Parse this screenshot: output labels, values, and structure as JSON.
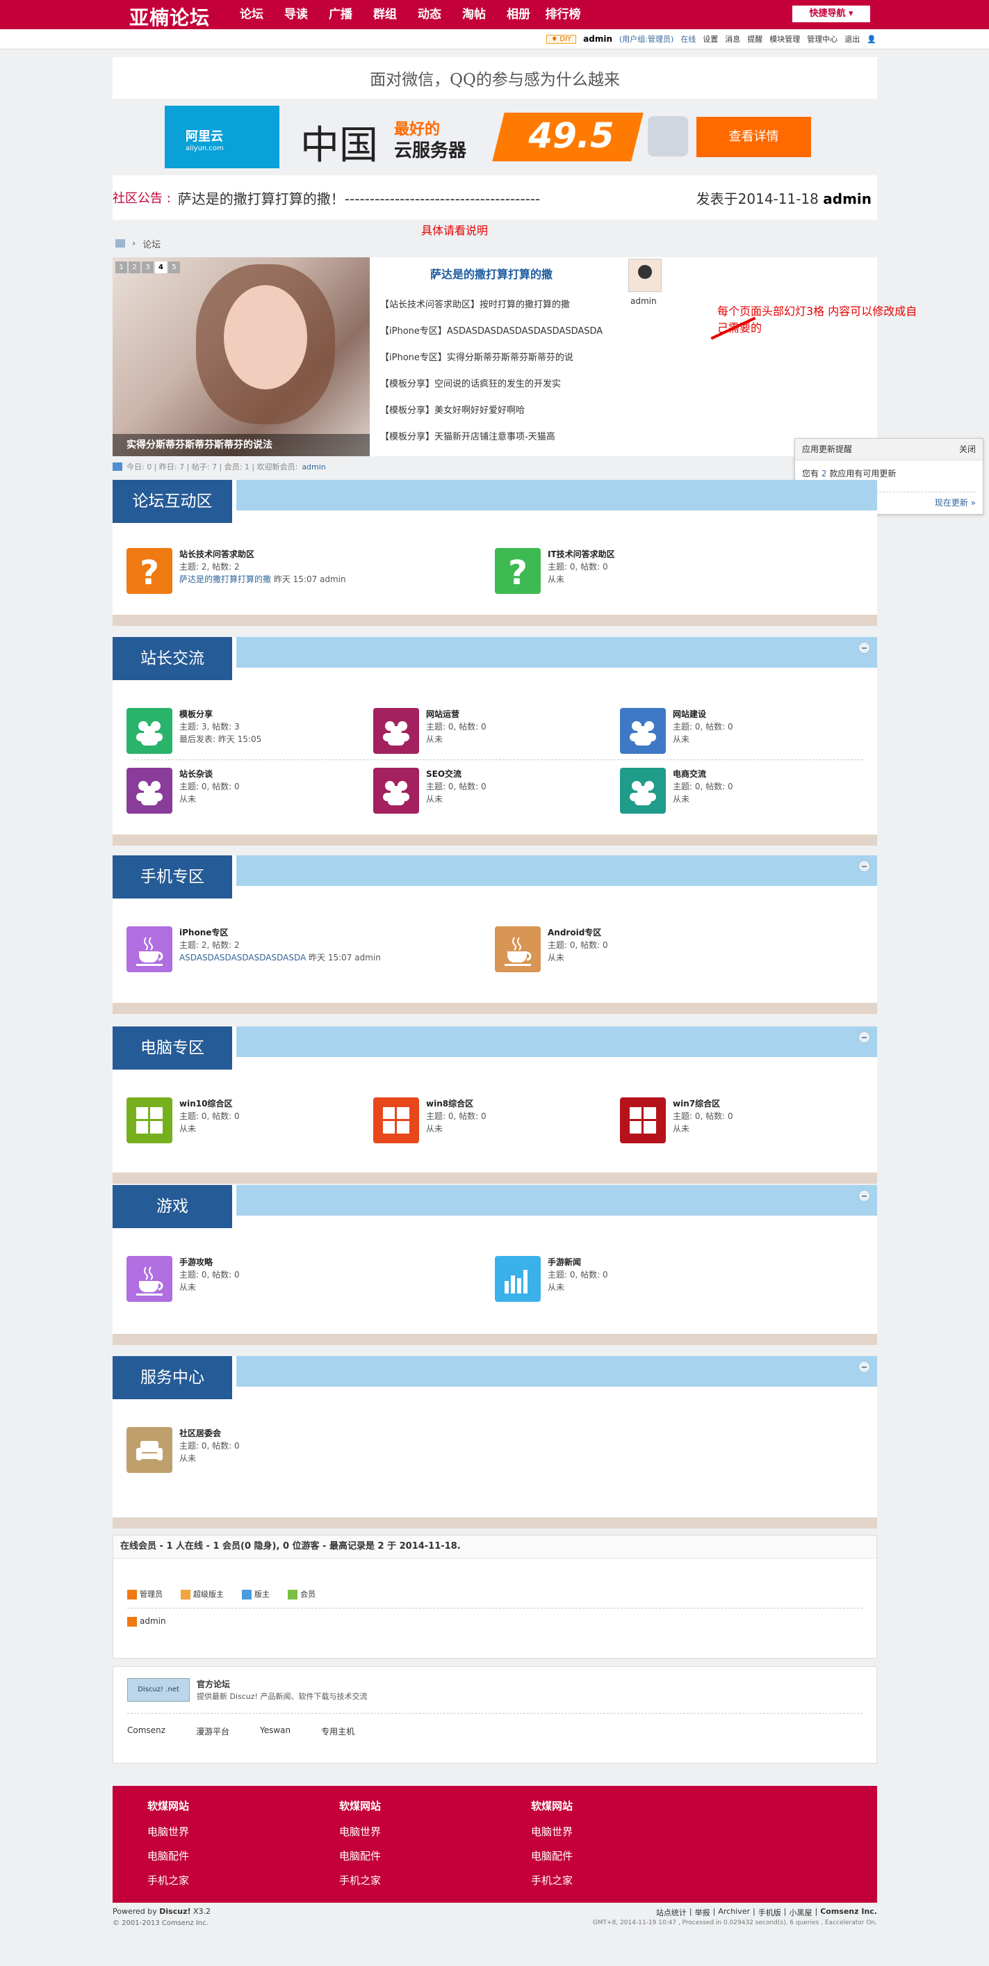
{
  "header": {
    "logo": "亚楠论坛",
    "nav": [
      "论坛",
      "导读",
      "广播",
      "群组",
      "动态",
      "淘帖",
      "相册",
      "排行榜"
    ],
    "quick": "快捷导航 ▾"
  },
  "userbar": {
    "diy": "♦ DIY",
    "name": "admin",
    "group": "(用户组:管理员)",
    "items": [
      "在线",
      "设置",
      "消息",
      "提醒",
      "模块管理",
      "管理中心",
      "退出"
    ]
  },
  "top_banner": {
    "text": "面对微信，QQ的参与感为什么越来"
  },
  "ad": {
    "brand": "阿里云",
    "brand_url": "aliyun.com",
    "china": "中国",
    "best": "最好的",
    "cloud": "云服务器",
    "price": "49.5",
    "button": "查看详情"
  },
  "notice": {
    "label": "社区公告 :",
    "text": "萨达是的撒打算打算的撒！---------------------------------------",
    "date": "发表于2014-11-18",
    "author": "admin",
    "note": "具体请看说明"
  },
  "breadcrumb": {
    "item": "论坛"
  },
  "slide": {
    "dots": [
      "1",
      "2",
      "3",
      "4",
      "5"
    ],
    "caption": "实得分斯蒂芬斯蒂芬斯蒂芬的说法",
    "hot_title": "萨达是的撒打算打算的撒",
    "hot_items": [
      "【站长技术问答求助区】按时打算的撒打算的撒",
      "【iPhone专区】ASDASDASDASDASDASDASDASDA",
      "【iPhone专区】实得分斯蒂芬斯蒂芬斯蒂芬的说",
      "【模板分享】空间说的话疯狂的发生的开发实",
      "【模板分享】美女好啊好好爱好啊哈",
      "【模板分享】天猫新开店铺注意事项-天猫高"
    ],
    "user": "admin",
    "note": "每个页面头部幻灯3格 内容可以修改成自己需要的"
  },
  "stats": {
    "text": "今日: 0 | 昨日: 7 | 帖子: 7 | 会员: 1 | 欢迎新会员:",
    "new_member": "admin"
  },
  "popup": {
    "title": "应用更新提醒",
    "close": "关闭",
    "body_pre": "您有",
    "count": "2",
    "body_post": "款应用有可用更新",
    "action": "现在更新 »"
  },
  "sections": {
    "s1": {
      "title": "论坛互动区"
    },
    "s2": {
      "title": "站长交流"
    },
    "s3": {
      "title": "手机专区"
    },
    "s4": {
      "title": "电脑专区"
    },
    "s5": {
      "title": "游戏"
    },
    "s6": {
      "title": "服务中心"
    }
  },
  "forums": {
    "f1": {
      "name": "站长技术问答求助区",
      "l1": "主题: 2, 帖数: 2",
      "l2a": "萨达是的撒打算打算的撒",
      "l2b": " 昨天 15:07 admin",
      "color": "#f07a12",
      "icon": "question-icon"
    },
    "f2": {
      "name": "IT技术问答求助区",
      "l1": "主题: 0, 帖数: 0",
      "l2": "从未",
      "color": "#3dba52",
      "icon": "question-icon"
    },
    "f3": {
      "name": "模板分享",
      "l1": "主题: 3, 帖数: 3",
      "l2": "最后发表: 昨天 15:05",
      "color": "#2ab36a",
      "icon": "group-icon"
    },
    "f4": {
      "name": "网站运营",
      "l1": "主题: 0, 帖数: 0",
      "l2": "从未",
      "color": "#a3215f",
      "icon": "group-icon"
    },
    "f5": {
      "name": "网站建设",
      "l1": "主题: 0, 帖数: 0",
      "l2": "从未",
      "color": "#3f79c6",
      "icon": "group-icon"
    },
    "f6": {
      "name": "站长杂谈",
      "l1": "主题: 0, 帖数: 0",
      "l2": "从未",
      "color": "#8a3c9a",
      "icon": "group-icon"
    },
    "f7": {
      "name": "SEO交流",
      "l1": "主题: 0, 帖数: 0",
      "l2": "从未",
      "color": "#a3215f",
      "icon": "group-icon"
    },
    "f8": {
      "name": "电商交流",
      "l1": "主题: 0, 帖数: 0",
      "l2": "从未",
      "color": "#1f9c8a",
      "icon": "group-icon"
    },
    "f9": {
      "name": "iPhone专区",
      "l1": "主题: 2, 帖数: 2",
      "l2a": "ASDASDASDASDASDASDASDA",
      "l2b": " 昨天 15:07 admin",
      "color": "#b06ee0",
      "icon": "cup-icon"
    },
    "f10": {
      "name": "Android专区",
      "l1": "主题: 0, 帖数: 0",
      "l2": "从未",
      "color": "#d99553",
      "icon": "cup-icon"
    },
    "f11": {
      "name": "win10综合区",
      "l1": "主题: 0, 帖数: 0",
      "l2": "从未",
      "color": "#76b01d",
      "icon": "windows-icon"
    },
    "f12": {
      "name": "win8综合区",
      "l1": "主题: 0, 帖数: 0",
      "l2": "从未",
      "color": "#e8471b",
      "icon": "windows-icon"
    },
    "f13": {
      "name": "win7综合区",
      "l1": "主题: 0, 帖数: 0",
      "l2": "从未",
      "color": "#b5121b",
      "icon": "windows-icon"
    },
    "f14": {
      "name": "手游攻略",
      "l1": "主题: 0, 帖数: 0",
      "l2": "从未",
      "color": "#b06ee0",
      "icon": "cup-icon"
    },
    "f15": {
      "name": "手游新闻",
      "l1": "主题: 0, 帖数: 0",
      "l2": "从未",
      "color": "#3ab1ea",
      "icon": "bars-icon"
    },
    "f16": {
      "name": "社区居委会",
      "l1": "主题: 0, 帖数: 0",
      "l2": "从未",
      "color": "#bfa06c",
      "icon": "sofa-icon"
    }
  },
  "online": {
    "title": "在线会员 - 1 人在线 - 1 会员(0 隐身), 0 位游客 - 最高记录是 2 于 2014-11-18.",
    "legend": [
      "管理员",
      "超级版主",
      "版主",
      "会员"
    ],
    "user": "admin"
  },
  "links": {
    "logo": "Discuz! .net",
    "title": "官方论坛",
    "desc": "提供最新 Discuz! 产品新闻、软件下载与技术交流",
    "items": [
      "Comsenz",
      "漫游平台",
      "Yeswan",
      "专用主机"
    ]
  },
  "footer": {
    "cols": [
      {
        "title": "软煤网站",
        "items": [
          "电脑世界",
          "电脑配件",
          "手机之家"
        ]
      },
      {
        "title": "软煤网站",
        "items": [
          "电脑世界",
          "电脑配件",
          "手机之家"
        ]
      },
      {
        "title": "软煤网站",
        "items": [
          "电脑世界",
          "电脑配件",
          "手机之家"
        ]
      }
    ],
    "powered": "Powered by",
    "discuz": "Discuz!",
    "version": "X3.2",
    "copyright": "© 2001-2013 Comsenz Inc.",
    "links": [
      "站点统计",
      "|",
      "举报",
      "|",
      "Archiver",
      "|",
      "手机版",
      "|",
      "小黑屋",
      "|",
      "Comsenz Inc."
    ],
    "gmt": "GMT+8, 2014-11-19 10:47 , Processed in 0.029432 second(s), 6 queries , Eaccelerator On."
  }
}
